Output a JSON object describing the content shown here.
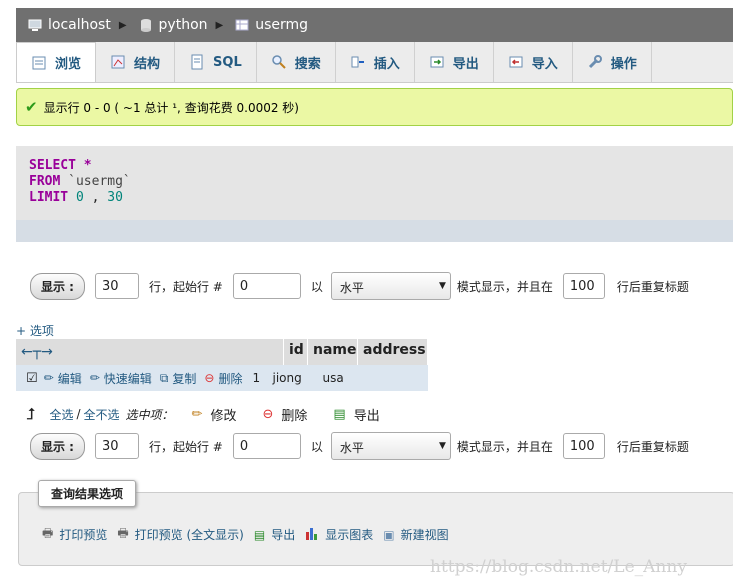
{
  "breadcrumb": {
    "server": "localhost",
    "database": "python",
    "table": "usermg"
  },
  "tabs": [
    "浏览",
    "结构",
    "SQL",
    "搜索",
    "插入",
    "导出",
    "导入",
    "操作"
  ],
  "message": {
    "text": "显示行 0 - 0 ( ~1 总计 ¹, 查询花费 0.0002 秒)"
  },
  "sql": {
    "select": "SELECT",
    "star": "*",
    "from": "FROM",
    "table": "`usermg`",
    "limit": "LIMIT",
    "offset": "0",
    "comma": ",",
    "count": "30"
  },
  "nav": {
    "show_label": "显示 :",
    "rows": "30",
    "start_text": "行，起始行 #",
    "start": "0",
    "in_text": "以",
    "mode": "水平",
    "mode_text": "模式显示，并且在",
    "repeat": "100",
    "repeat_text": "行后重复标题"
  },
  "options_link": "+ 选项",
  "table": {
    "columns": [
      "id",
      "name",
      "address"
    ],
    "row": {
      "edit": "编辑",
      "quick_edit": "快速编辑",
      "copy": "复制",
      "delete": "删除",
      "id": "1",
      "name": "jiong",
      "address": "usa"
    }
  },
  "bulk": {
    "select_all": "全选",
    "sep": "/",
    "deselect_all": "全不选",
    "selected_text": "选中项：",
    "change": "修改",
    "delete": "删除",
    "export": "导出"
  },
  "query_results": {
    "legend": "查询结果选项",
    "print": "打印预览",
    "print_full": "打印预览 (全文显示)",
    "export": "导出",
    "chart": "显示图表",
    "view": "新建视图"
  },
  "watermark": "https://blog.csdn.net/Le_Anny",
  "colors": {
    "topbar": "#707070",
    "success_bg": "#ebf8a4",
    "link": "#235a81",
    "sql_keyword": "#990099"
  }
}
